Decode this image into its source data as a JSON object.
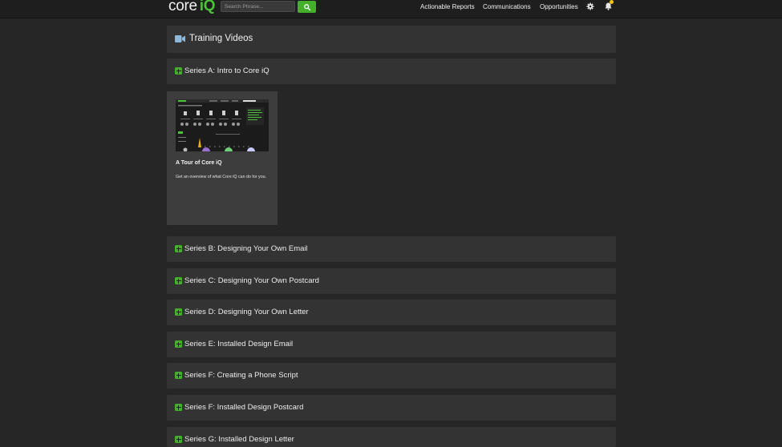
{
  "logo": {
    "core": "core",
    "iq": "iQ"
  },
  "search": {
    "placeholder": "Search Phrase..."
  },
  "nav": {
    "links": [
      "Actionable Reports",
      "Communications",
      "Opportunities"
    ]
  },
  "header": {
    "title": "Training Videos"
  },
  "series_a": {
    "label": "Series A: Intro to Core iQ"
  },
  "video": {
    "title": "A Tour of Core iQ",
    "description": "Get an overview of what Core iQ can do for you."
  },
  "series": [
    "Series B: Designing Your Own Email",
    "Series C: Designing Your Own Postcard",
    "Series D: Designing Your Own Letter",
    "Series E: Installed Design Email",
    "Series F: Creating a Phone Script",
    "Series F: Installed Design Postcard",
    "Series G: Installed Design Letter"
  ],
  "colors": {
    "accent": "#43b02a",
    "panel": "#333333",
    "background": "#262626",
    "notification": "#f1c40f"
  },
  "icons": [
    "search-icon",
    "gear-icon",
    "bell-icon",
    "video-camera-icon",
    "plus-square-icon"
  ]
}
